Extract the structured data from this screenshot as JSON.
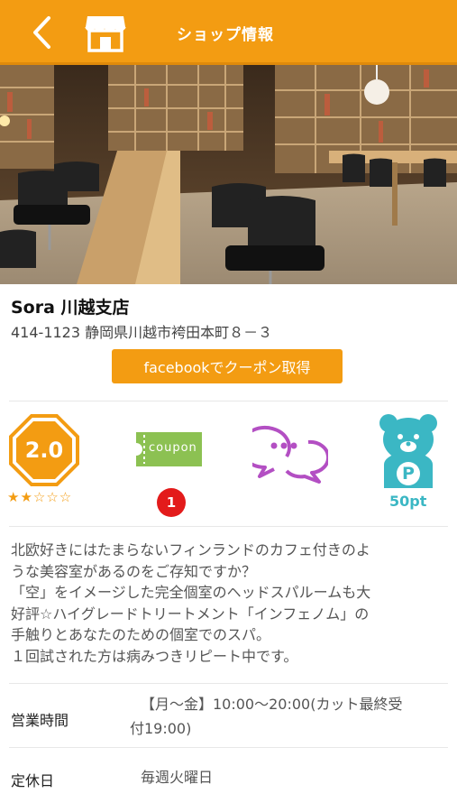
{
  "header": {
    "title": "ショップ情報",
    "back_icon": "chevron-left-icon",
    "shop_icon": "storefront-icon",
    "color": "#f39c12"
  },
  "hero": {
    "icon": "salon-interior-photo"
  },
  "shop": {
    "name": "Sora 川越支店",
    "address": "414-1123 静岡県川越市袴田本町８－３"
  },
  "facebook_button": {
    "label": "facebookでクーポン取得"
  },
  "stats": {
    "rating": "2.0",
    "rating_value": 2,
    "rating_max": 5,
    "stars_display": "★★☆☆☆",
    "coupon_label": "coupon",
    "coupon_count": "1",
    "points": "50pt",
    "point_badge_letter": "P",
    "colors": {
      "orange": "#f39c12",
      "green": "#8cc152",
      "purple": "#b34fc3",
      "teal": "#3bb7c4",
      "red": "#e31b1b"
    }
  },
  "description": "北欧好きにはたまらないフィンランドのカフェ付きのよ\nうな美容室があるのをご存知ですか？\n「空」をイメージした完全個室のヘッドスパルームも大\n好評☆ハイグレードトリートメント「インフェノム」の\n手触りとあなたのための個室でのスパ。\n１回試された方は病みつきリピート中です。",
  "info": {
    "hours_label": "営業時間",
    "hours_line1": "【月～金】10:00～20:00(カット最終受",
    "hours_line2": "付19:00)",
    "closed_label": "定休日",
    "closed_value": "毎週火曜日"
  }
}
